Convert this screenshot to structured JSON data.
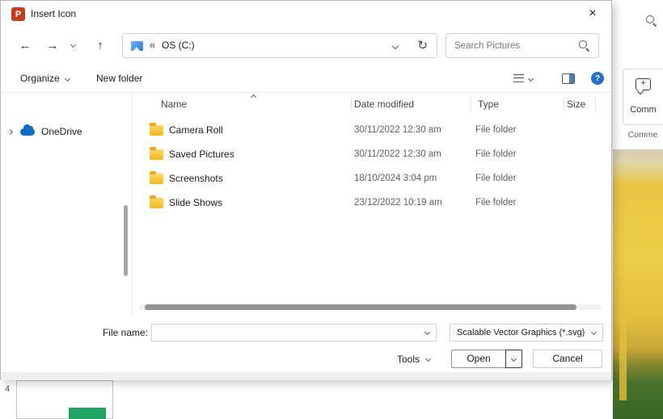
{
  "titlebar": {
    "title": "Insert Icon"
  },
  "icons": {
    "back": "←",
    "forward": "→",
    "up": "↑",
    "refresh": "↻",
    "close": "×",
    "crumb_chevrons": "«",
    "ppt_letter": "P",
    "help": "?"
  },
  "nav": {
    "crumb": "OS (C:)",
    "search_placeholder": "Search Pictures"
  },
  "toolbar": {
    "organize_label": "Organize",
    "new_folder_label": "New folder"
  },
  "sidebar": {
    "onedrive_label": "OneDrive"
  },
  "list": {
    "columns": {
      "name": "Name",
      "date": "Date modified",
      "type": "Type",
      "size": "Size"
    },
    "rows": [
      {
        "name": "Camera Roll",
        "date": "30/11/2022 12:30 am",
        "type": "File folder"
      },
      {
        "name": "Saved Pictures",
        "date": "30/11/2022 12:30 am",
        "type": "File folder"
      },
      {
        "name": "Screenshots",
        "date": "18/10/2024 3:04 pm",
        "type": "File folder"
      },
      {
        "name": "Slide Shows",
        "date": "23/12/2022 10:19 am",
        "type": "File folder"
      }
    ]
  },
  "footer": {
    "file_name_label": "File name:",
    "file_name_value": "",
    "file_type_value": "Scalable Vector Graphics (*.svg)",
    "tools_label": "Tools",
    "open_label": "Open",
    "cancel_label": "Cancel"
  },
  "background": {
    "comment_button_label": "Comm",
    "comments_group_label": "Comme",
    "slide_number": "4"
  },
  "colors": {
    "powerpoint_brand": "#c43e1c",
    "folder_yellow": "#f7b61e",
    "onedrive_blue": "#0f6cbd",
    "help_blue": "#2470c8",
    "photo_yellow": "#e8c645",
    "photo_green": "#3f6b28",
    "thumbnail_green": "#21a366"
  }
}
